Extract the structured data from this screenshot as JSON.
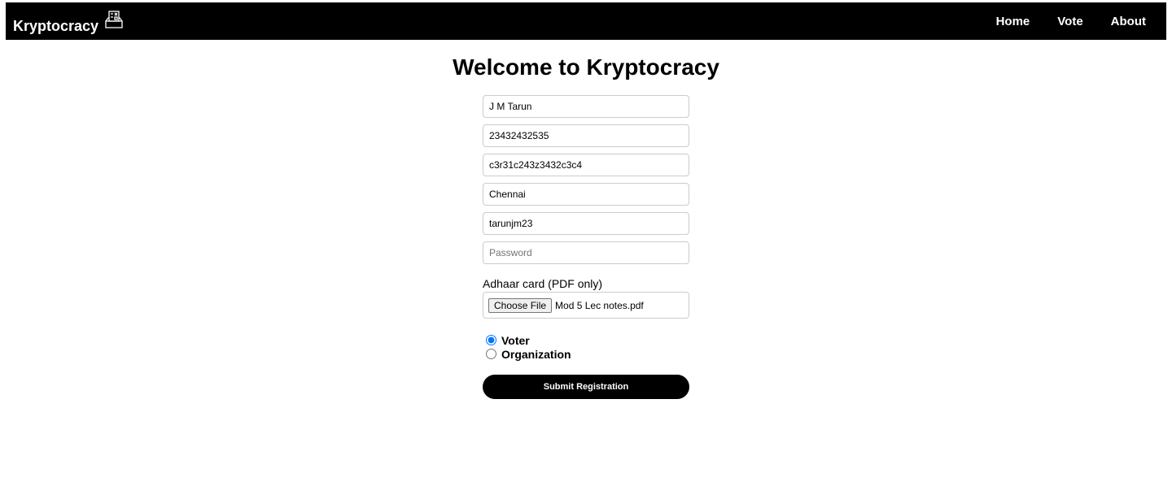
{
  "nav": {
    "brand": "Kryptocracy",
    "links": [
      "Home",
      "Vote",
      "About"
    ]
  },
  "title": "Welcome to Kryptocracy",
  "form": {
    "fields": [
      {
        "value": "J M Tarun"
      },
      {
        "value": "23432432535"
      },
      {
        "value": "c3r31c243z3432c3c4"
      },
      {
        "value": "Chennai"
      },
      {
        "value": "tarunjm23"
      },
      {
        "value": "",
        "placeholder": "Password"
      }
    ],
    "file_label": "Adhaar card (PDF only)",
    "file_button": "Choose File",
    "file_name": "Mod 5 Lec notes.pdf",
    "roles": [
      {
        "label": "Voter",
        "checked": true
      },
      {
        "label": "Organization",
        "checked": false
      }
    ],
    "submit": "Submit Registration"
  }
}
